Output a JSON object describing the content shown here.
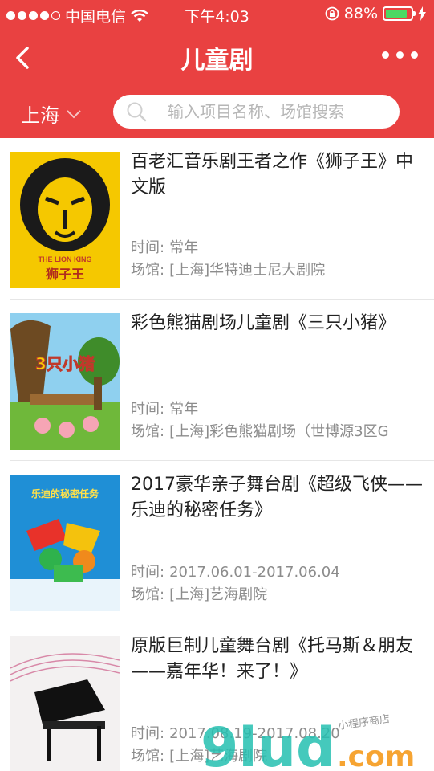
{
  "status_bar": {
    "carrier": "中国电信",
    "time": "下午4:03",
    "battery": "88%",
    "battery_level": 0.88
  },
  "navbar": {
    "title": "儿童剧"
  },
  "filter": {
    "city": "上海",
    "search_placeholder": "输入项目名称、场馆搜索"
  },
  "labels": {
    "time": "时间:",
    "venue": "场馆:"
  },
  "shows": [
    {
      "title": "百老汇音乐剧王者之作《狮子王》中文版",
      "time": "常年",
      "venue": "[上海]华特迪士尼大剧院",
      "poster_text": "狮子王",
      "poster_brand": "THE LION KING",
      "poster_icon": "lion-poster"
    },
    {
      "title": "彩色熊猫剧场儿童剧《三只小猪》",
      "time": "常年",
      "venue": "[上海]彩色熊猫剧场（世博源3区G",
      "poster_text": "3只小猪",
      "poster_icon": "three-pigs-poster"
    },
    {
      "title": "2017豪华亲子舞台剧《超级飞侠——乐迪的秘密任务》",
      "time": "2017.06.01-2017.06.04",
      "venue": "[上海]艺海剧院",
      "poster_text": "乐迪的秘密任务",
      "poster_icon": "super-wings-poster"
    },
    {
      "title": "原版巨制儿童舞台剧《托马斯＆朋友——嘉年华！来了！》",
      "time": "2017.08.19-2017.08.20",
      "venue": "[上海]艺海剧院",
      "poster_icon": "piano-poster"
    }
  ],
  "watermark": {
    "main": "9lud",
    "suffix": ".com",
    "tag": "小程序商店"
  },
  "colors": {
    "brand": "#e94141",
    "meta_text": "#8c8c8c"
  }
}
